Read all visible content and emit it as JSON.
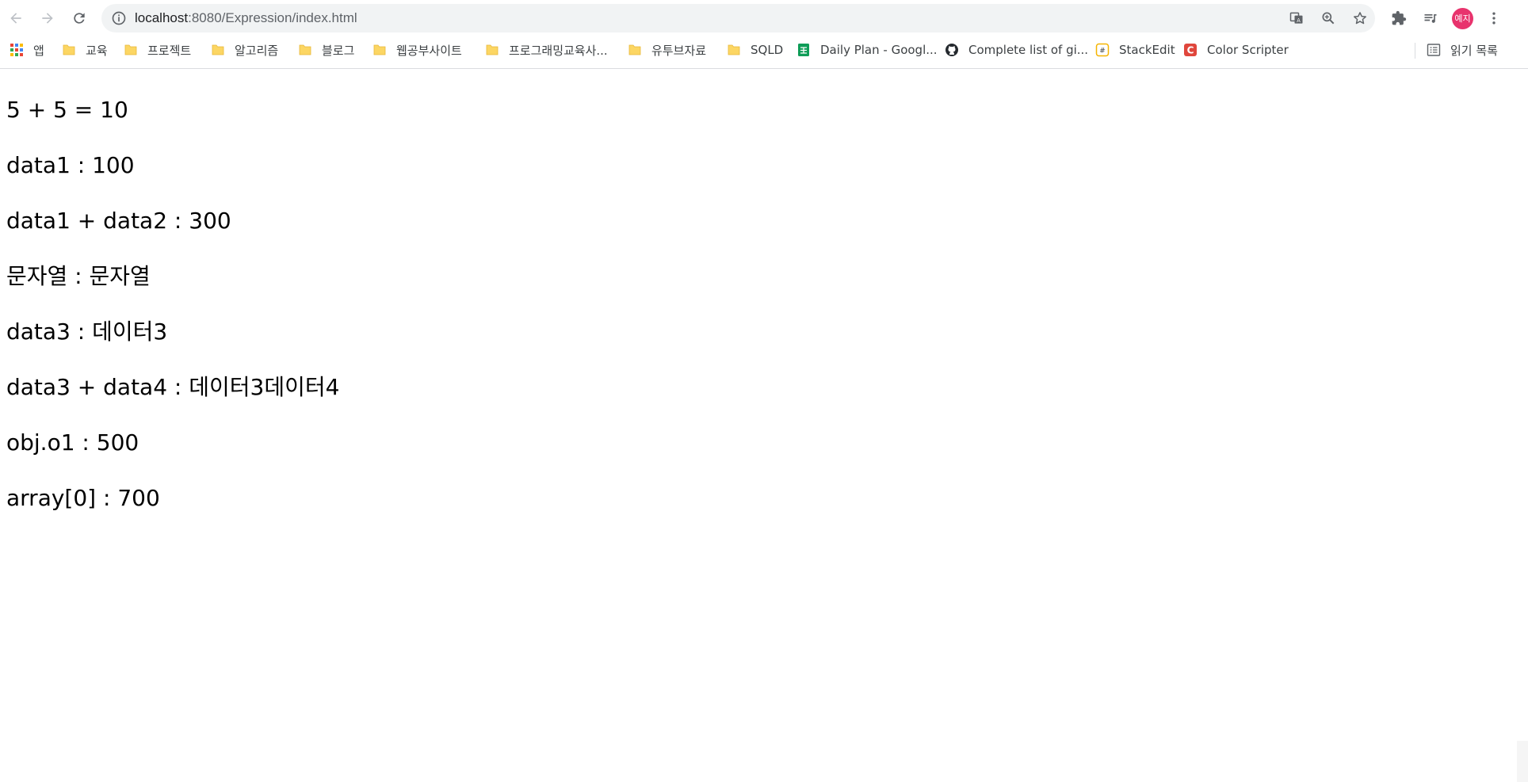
{
  "address_bar": {
    "url_host": "localhost",
    "url_rest": ":8080/Expression/index.html"
  },
  "profile": {
    "avatar_text": "예지",
    "avatar_color": "#e8336d"
  },
  "bookmarks": {
    "apps_label": "앱",
    "items": [
      {
        "label": "교육",
        "icon": "folder-icon"
      },
      {
        "label": "프로젝트",
        "icon": "folder-icon"
      },
      {
        "label": "알고리즘",
        "icon": "folder-icon"
      },
      {
        "label": "블로그",
        "icon": "folder-icon"
      },
      {
        "label": "웹공부사이트",
        "icon": "folder-icon"
      },
      {
        "label": "프로그래밍교육사...",
        "icon": "folder-icon"
      },
      {
        "label": "유투브자료",
        "icon": "folder-icon"
      },
      {
        "label": "SQLD",
        "icon": "folder-icon"
      },
      {
        "label": "Daily Plan - Googl...",
        "icon": "sheets-icon"
      },
      {
        "label": "Complete list of gi...",
        "icon": "github-icon"
      },
      {
        "label": "StackEdit",
        "icon": "stackedit-icon"
      },
      {
        "label": "Color Scripter",
        "icon": "colorscripter-icon"
      }
    ],
    "reading_list_label": "읽기 목록"
  },
  "content": {
    "lines": [
      "5 + 5 = 10",
      "data1 : 100",
      "data1 + data2 : 300",
      "문자열 : 문자열",
      "data3 : 데이터3",
      "data3 + data4 : 데이터3데이터4",
      "obj.o1 : 500",
      "array[0] : 700"
    ]
  }
}
